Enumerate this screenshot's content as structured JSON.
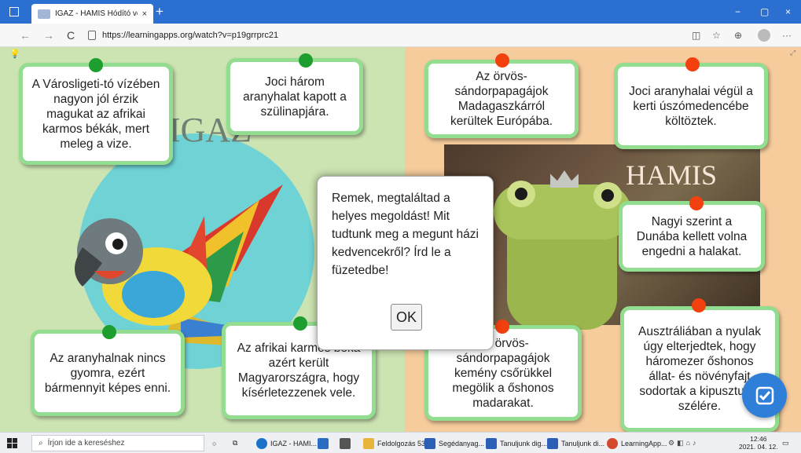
{
  "browser": {
    "tab_title": "IGAZ - HAMIS Hódító vendégek",
    "tab_close": "×",
    "new_tab": "+",
    "url": "https://learningapps.org/watch?v=p19grrprc21",
    "back": "←",
    "forward": "→",
    "reload": "C",
    "minimize": "−",
    "maximize": "▢",
    "close": "×",
    "more": "···"
  },
  "labels": {
    "true_word": "IGAZ",
    "false_word": "HAMIS"
  },
  "cards": [
    {
      "id": "card-varosligeti",
      "text": "A Városligeti-tó vízében nagyon jól érzik magukat az afrikai karmos békák, mert meleg a vize.",
      "dot": "green"
    },
    {
      "id": "card-joci-harom",
      "text": "Joci három aranyhalat kapott a szülinapjára.",
      "dot": "green"
    },
    {
      "id": "card-orvos-madagaszkar",
      "text": "Az örvös-sándorpapagájok Madagaszkárról kerültek Európába.",
      "dot": "red"
    },
    {
      "id": "card-joci-uszomedence",
      "text": "Joci aranyhalai végül a kerti úszómedencébe költöztek.",
      "dot": "red"
    },
    {
      "id": "card-nagyi-duna",
      "text": "Nagyi szerint a Dunába kellett volna engedni a halakat.",
      "dot": "red"
    },
    {
      "id": "card-aranyhal-gyomor",
      "text": "Az aranyhalnak nincs gyomra, ezért bármennyit képes enni.",
      "dot": "green"
    },
    {
      "id": "card-afrikai-beka",
      "text": "Az afrikai karmos béka azért került Magyarországra, hogy kísérletezzenek vele.",
      "dot": "green"
    },
    {
      "id": "card-orvos-csor",
      "text": "Az örvös-sándorpapagájok kemény csőrükkel megölik a őshonos madarakat.",
      "dot": "red"
    },
    {
      "id": "card-ausztralia",
      "text": "Ausztráliában a nyulak úgy elterjedtek, hogy háromezer őshonos állat- és növényfajt sodortak a kipusztulás szélére.",
      "dot": "red"
    }
  ],
  "modal": {
    "message": "Remek, megtaláltad a helyes megoldást! Mit tudtunk meg a megunt házi kedvencekről? Írd le a füzetedbe!",
    "ok_label": "OK"
  },
  "colors": {
    "green_dot": "#1e9e2e",
    "red_dot": "#f2400f",
    "card_border": "#92dd8f",
    "left_panel": "#cce3b2",
    "right_panel": "#f6cc9c",
    "fab": "#2f7fd8"
  },
  "taskbar": {
    "search_placeholder": "Írjon ide a kereséshez",
    "items": [
      {
        "label": "IGAZ - HAMI...",
        "icon": "edge-icon",
        "color": "#1a73c9"
      },
      {
        "label": "",
        "icon": "mail-icon",
        "color": "#2a6cc2"
      },
      {
        "label": "",
        "icon": "calculator-icon",
        "color": "#555"
      },
      {
        "label": "Feldolgozás 53",
        "icon": "folder-icon",
        "color": "#e9b43a"
      },
      {
        "label": "Segédanyag...",
        "icon": "word-icon",
        "color": "#2b5fb5"
      },
      {
        "label": "Tanuljunk dig...",
        "icon": "word-icon",
        "color": "#2b5fb5"
      },
      {
        "label": "Tanuljunk di...",
        "icon": "word-icon",
        "color": "#2b5fb5"
      },
      {
        "label": "LearningApp...",
        "icon": "chrome-icon",
        "color": "#d34a2b"
      }
    ],
    "time": "12:46",
    "date": "2021. 04. 12."
  }
}
